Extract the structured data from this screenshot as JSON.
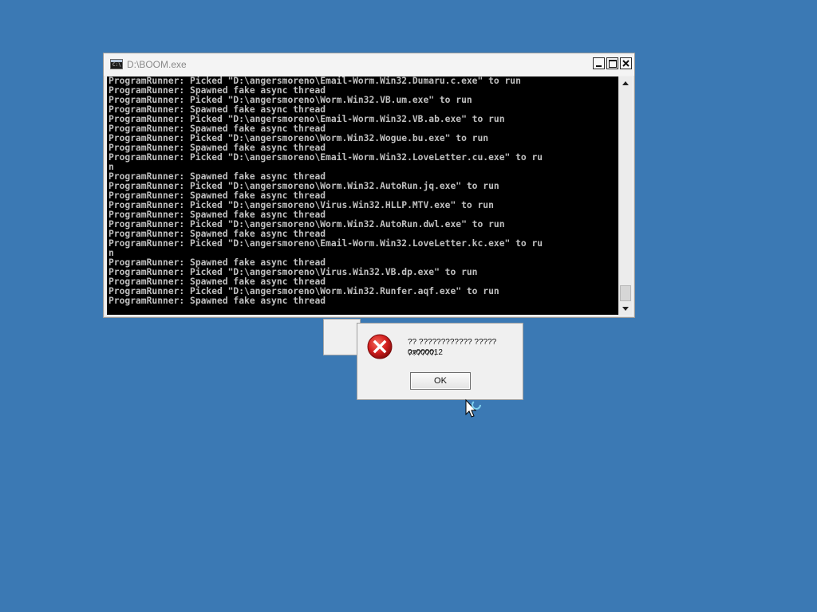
{
  "console": {
    "title": "D:\\BOOM.exe",
    "icon_label": "C:\\",
    "lines": [
      "ProgramRunner: Picked \"D:\\angersmoreno\\Email-Worm.Win32.Dumaru.c.exe\" to run",
      "ProgramRunner: Spawned fake async thread",
      "ProgramRunner: Picked \"D:\\angersmoreno\\Worm.Win32.VB.um.exe\" to run",
      "ProgramRunner: Spawned fake async thread",
      "ProgramRunner: Picked \"D:\\angersmoreno\\Email-Worm.Win32.VB.ab.exe\" to run",
      "ProgramRunner: Spawned fake async thread",
      "ProgramRunner: Picked \"D:\\angersmoreno\\Worm.Win32.Wogue.bu.exe\" to run",
      "ProgramRunner: Spawned fake async thread",
      "ProgramRunner: Picked \"D:\\angersmoreno\\Email-Worm.Win32.LoveLetter.cu.exe\" to ru",
      "n",
      "ProgramRunner: Spawned fake async thread",
      "ProgramRunner: Picked \"D:\\angersmoreno\\Worm.Win32.AutoRun.jq.exe\" to run",
      "ProgramRunner: Spawned fake async thread",
      "ProgramRunner: Picked \"D:\\angersmoreno\\Virus.Win32.HLLP.MTV.exe\" to run",
      "ProgramRunner: Spawned fake async thread",
      "ProgramRunner: Picked \"D:\\angersmoreno\\Worm.Win32.AutoRun.dwl.exe\" to run",
      "ProgramRunner: Spawned fake async thread",
      "ProgramRunner: Picked \"D:\\angersmoreno\\Email-Worm.Win32.LoveLetter.kc.exe\" to ru",
      "n",
      "ProgramRunner: Spawned fake async thread",
      "ProgramRunner: Picked \"D:\\angersmoreno\\Virus.Win32.VB.dp.exe\" to run",
      "ProgramRunner: Spawned fake async thread",
      "ProgramRunner: Picked \"D:\\angersmoreno\\Worm.Win32.Runfer.aqf.exe\" to run",
      "ProgramRunner: Spawned fake async thread"
    ]
  },
  "error_dialog": {
    "message": "?? ???????????? ????? ??????:",
    "code": "0x000012",
    "ok_label": "OK"
  },
  "colors": {
    "desktop": "#3b79b4",
    "console_bg": "#000000",
    "console_text": "#c0c0c0",
    "error_red": "#d42020"
  },
  "icons": {
    "console": "console-icon",
    "error": "error-icon",
    "cursor": "busy-cursor-icon"
  }
}
